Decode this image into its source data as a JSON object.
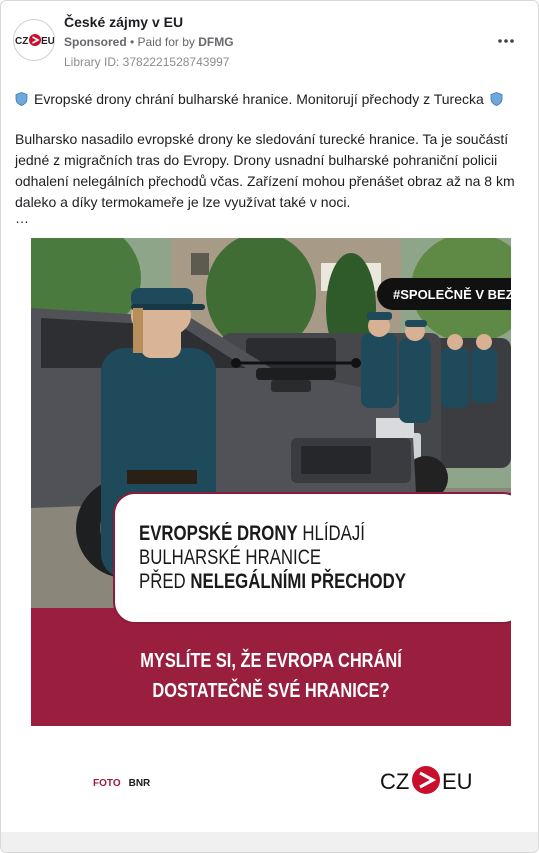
{
  "post": {
    "page_name": "České zájmy v EU",
    "sponsored": "Sponsored",
    "separator": " • ",
    "paid_for_by_label": "Paid for by ",
    "paid_for_by_name": "DFMG",
    "library_id": "Library ID: 3782221528743997",
    "more_icon": "more-horizontal-icon"
  },
  "avatar": {
    "logo_left": "CZ",
    "logo_right": "EU"
  },
  "text": {
    "headline": "Evropské drony chrání bulharské hranice. Monitorují přechody z Turecka",
    "headline_icon": "shield-icon",
    "body": "Bulharsko nasadilo evropské drony ke sledování turecké hranice. Ta je součástí jedné z migračních tras do Evropy. Drony usnadní bulharské pohraniční policii odhalení nelegálních přechodů včas. Zařízení mohou přenášet obraz až na 8 km daleko a díky termokameře je lze využívat také v noci.",
    "ellipsis": "…"
  },
  "creative": {
    "tag": "#SPOLEČNĚ V BEZPEČÍ",
    "box_line1_strong": "EVROPSKÉ DRONY",
    "box_line1_rest": " HLÍDAJÍ",
    "box_line2": "BULHARSKÉ HRANICE",
    "box_line3_pre": "PŘED ",
    "box_line3_strong": "NELEGÁLNÍMI PŘECHODY",
    "question_line1": "MYSLÍTE SI, ŽE EVROPA CHRÁNÍ",
    "question_line2": "DOSTATEČNĚ  SVÉ HRANICE?",
    "credit_foto": "FOTO",
    "credit_source": "BNR",
    "logo_left": "CZ",
    "logo_right": "EU"
  },
  "colors": {
    "brand_red": "#9a1e3e",
    "logo_red": "#c8102e",
    "uniform": "#1f4a5c",
    "text_primary": "#1c1e21",
    "text_secondary": "#65676b"
  }
}
